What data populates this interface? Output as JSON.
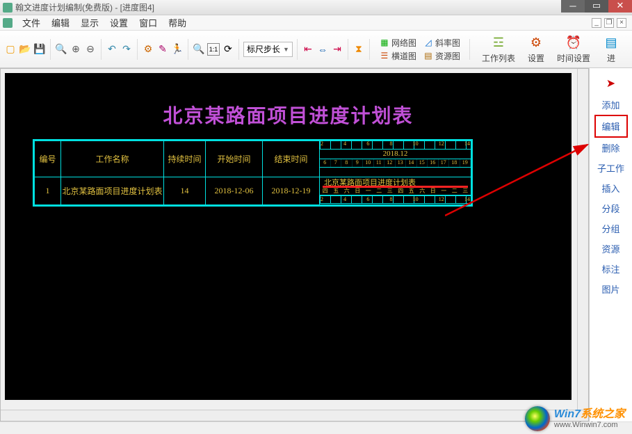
{
  "window": {
    "title": "翰文进度计划编制(免费版) - [进度图4]"
  },
  "menu": {
    "items": [
      "文件",
      "编辑",
      "显示",
      "设置",
      "窗口",
      "帮助"
    ]
  },
  "toolbar": {
    "ruler_select": "标尺步长",
    "groups": {
      "view1": {
        "net": "网络图",
        "cross": "横道图"
      },
      "view2": {
        "slope": "斜率图",
        "res": "资源图"
      },
      "worklist": "工作列表",
      "settings": "设置",
      "timeset": "时间设置",
      "prog": "进"
    }
  },
  "right_panel": {
    "items": [
      "添加",
      "编辑",
      "删除",
      "子工作",
      "插入",
      "分段",
      "分组",
      "资源",
      "标注",
      "图片"
    ],
    "selected_index": 1
  },
  "chart": {
    "title": "北京某路面项目进度计划表",
    "headers": {
      "id": "编号",
      "name": "工作名称",
      "duration": "持续时间",
      "start": "开始时间",
      "end": "结束时间"
    },
    "row": {
      "id": "1",
      "name": "北京某路面项目进度计划表",
      "duration": "14",
      "start": "2018-12-06",
      "end": "2018-12-19"
    },
    "calendar": {
      "month": "2018.12",
      "top_ticks": [
        "2",
        "4",
        "6",
        "8",
        "10",
        "12",
        "14"
      ],
      "day_nums": [
        "6",
        "7",
        "8",
        "9",
        "10",
        "11",
        "12",
        "13",
        "14",
        "15",
        "16",
        "17",
        "18",
        "19"
      ],
      "bar_label": "北京某路面项目进度计划表",
      "weekdays": [
        "四",
        "五",
        "六",
        "日",
        "一",
        "二",
        "三",
        "四",
        "五",
        "六",
        "日",
        "一",
        "二",
        "三"
      ],
      "bottom_ticks": [
        "2",
        "4",
        "6",
        "8",
        "10",
        "12",
        "14"
      ]
    }
  },
  "chart_data": {
    "type": "table",
    "title": "北京某路面项目进度计划表",
    "columns": [
      "编号",
      "工作名称",
      "持续时间",
      "开始时间",
      "结束时间"
    ],
    "rows": [
      [
        "1",
        "北京某路面项目进度计划表",
        14,
        "2018-12-06",
        "2018-12-19"
      ]
    ],
    "gantt": {
      "range": [
        "2018-12-06",
        "2018-12-19"
      ],
      "bars": [
        {
          "name": "北京某路面项目进度计划表",
          "start": "2018-12-06",
          "end": "2018-12-19"
        }
      ]
    }
  },
  "watermark": {
    "brand_a": "Win7",
    "brand_b": "系统之家",
    "url": "www.Winwin7.com"
  }
}
